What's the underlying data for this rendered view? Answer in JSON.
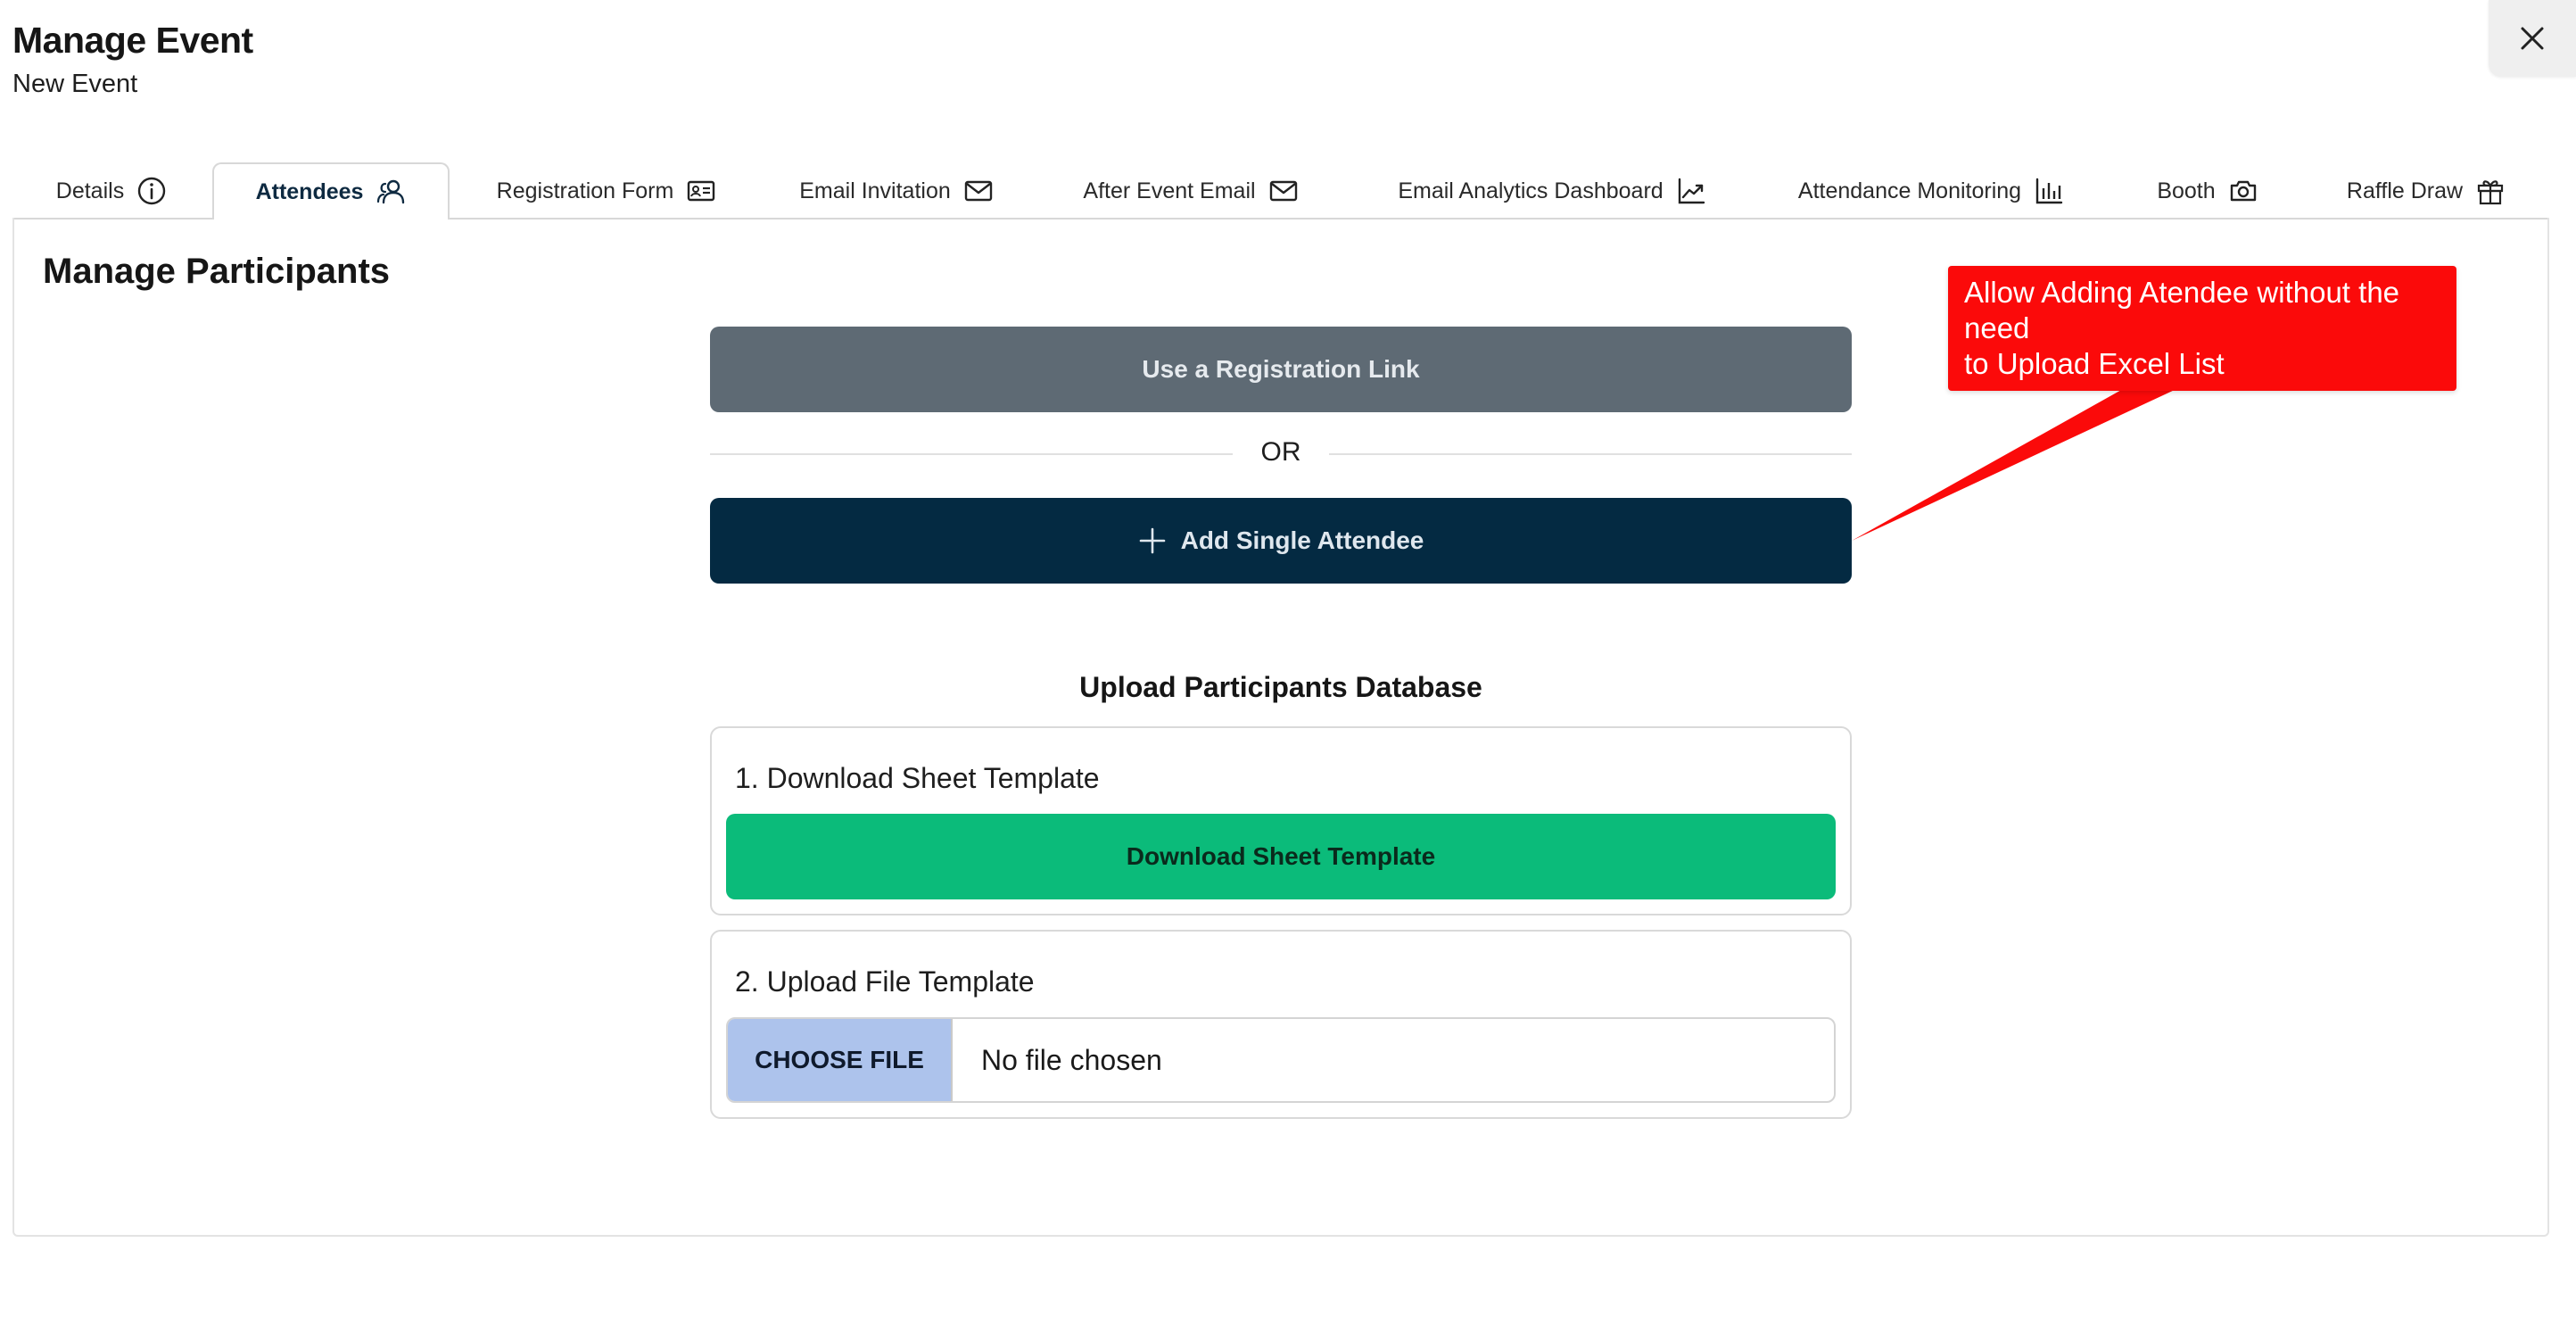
{
  "header": {
    "title": "Manage Event",
    "subtitle": "New Event",
    "close_icon": "close-icon"
  },
  "tabs": [
    {
      "label": "Details",
      "icon": "info-icon",
      "active": false
    },
    {
      "label": "Attendees",
      "icon": "users-icon",
      "active": true
    },
    {
      "label": "Registration Form",
      "icon": "id-card-icon",
      "active": false
    },
    {
      "label": "Email Invitation",
      "icon": "mail-icon",
      "active": false
    },
    {
      "label": "After Event Email",
      "icon": "mail-icon",
      "active": false
    },
    {
      "label": "Email Analytics Dashboard",
      "icon": "trend-chart-icon",
      "active": false
    },
    {
      "label": "Attendance Monitoring",
      "icon": "bar-chart-icon",
      "active": false
    },
    {
      "label": "Booth",
      "icon": "camera-icon",
      "active": false
    },
    {
      "label": "Raffle Draw",
      "icon": "gift-icon",
      "active": false
    }
  ],
  "main": {
    "title": "Manage Participants",
    "registration_link_label": "Use a Registration Link",
    "or_label": "OR",
    "add_single_label": "Add Single Attendee",
    "upload_heading": "Upload Participants Database",
    "step1_label": "1. Download Sheet Template",
    "download_button_label": "Download Sheet Template",
    "step2_label": "2. Upload File Template",
    "choose_file_label": "CHOOSE FILE",
    "file_status": "No file chosen"
  },
  "annotation": {
    "line1": "Allow Adding Atendee without the",
    "line2": "need",
    "line3": "to Upload Excel List",
    "color": "#fb0a0a"
  },
  "colors": {
    "primary_dark": "#042a42",
    "secondary_gray": "#5e6a74",
    "success_green": "#0bbb7a",
    "file_button_blue": "#adc3ec"
  }
}
